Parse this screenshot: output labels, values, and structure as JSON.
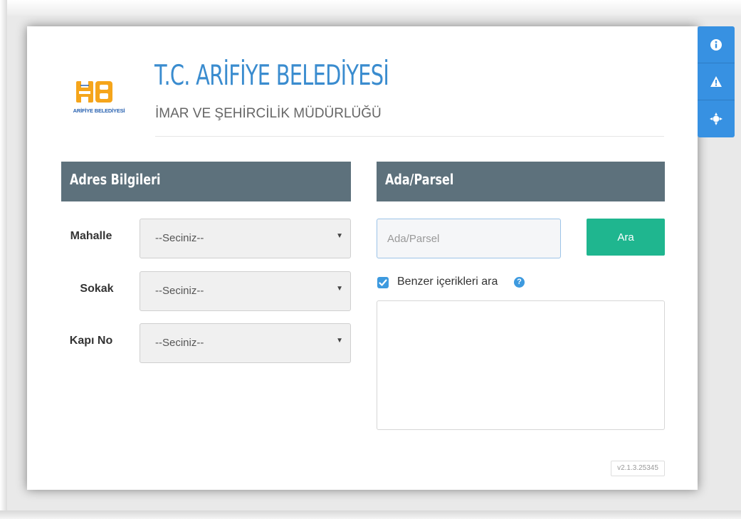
{
  "header": {
    "logo_text": "ARİFİYE BELEDİYESİ",
    "title": "T.C. ARİFİYE BELEDİYESİ",
    "subtitle": "İMAR VE ŞEHİRCİLİK MÜDÜRLÜĞÜ"
  },
  "address_section": {
    "heading": "Adres Bilgileri",
    "fields": [
      {
        "label": "Mahalle",
        "value": "--Seciniz--"
      },
      {
        "label": "Sokak",
        "value": "--Seciniz--"
      },
      {
        "label": "Kapı No",
        "value": "--Seciniz--"
      }
    ]
  },
  "parcel_section": {
    "heading": "Ada/Parsel",
    "input_value": "",
    "input_placeholder": "Ada/Parsel",
    "search_label": "Ara",
    "similar_checkbox_checked": true,
    "similar_checkbox_label": "Benzer içerikleri ara"
  },
  "version": "v2.1.3.25345",
  "side_toolbar": {
    "icons": [
      "info-icon",
      "warning-icon",
      "crosshair-icon"
    ]
  },
  "colors": {
    "accent_blue": "#3791e2",
    "title_blue": "#3a8ccf",
    "section_header": "#5d717c",
    "search_button": "#1fb68f",
    "logo_orange": "#f5a51b"
  }
}
